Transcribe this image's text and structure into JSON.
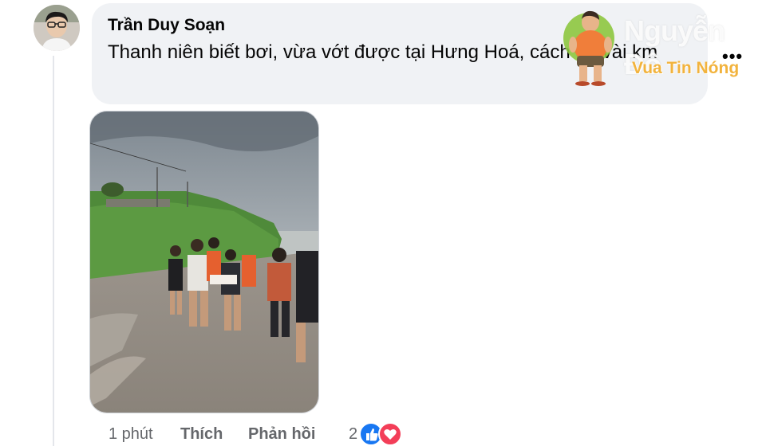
{
  "comment": {
    "author": "Trần Duy Soạn",
    "text": "Thanh niên biết bơi, vừa vớt được tại Hưng Hoá, cách đó vài km",
    "more_label": "•••"
  },
  "actions": {
    "time": "1 phút",
    "like_label": "Thích",
    "reply_label": "Phản hồi",
    "reaction_count": "2"
  },
  "watermark": {
    "line1": "Nguyễn Đô",
    "line2": "Vua Tin Nóng"
  },
  "colors": {
    "bubble_bg": "#f0f2f5",
    "like_blue": "#1877f2",
    "love_red": "#f33e58",
    "meta_gray": "#65676b"
  },
  "icons": [
    "avatar",
    "like-reaction-icon",
    "love-reaction-icon",
    "watermark-mascot"
  ]
}
